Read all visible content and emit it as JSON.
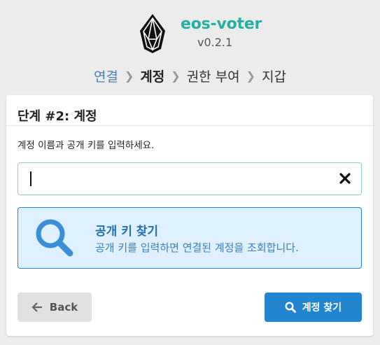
{
  "header": {
    "app_name": "eos-voter",
    "version": "v0.2.1",
    "logo_icon": "eos-logo-icon"
  },
  "steps": [
    {
      "label": "연결",
      "state": "link"
    },
    {
      "label": "계정",
      "state": "active"
    },
    {
      "label": "권한 부여",
      "state": "normal"
    },
    {
      "label": "지갑",
      "state": "normal"
    }
  ],
  "card": {
    "title": "단계 #2: 계정",
    "description": "계정 이름과 공개 키를 입력하세요.",
    "input": {
      "value": "",
      "placeholder": ""
    },
    "info": {
      "title": "공개 키 찾기",
      "text": "공개 키를 입력하면 연결된 계정을 조회합니다."
    },
    "back_label": "Back",
    "lookup_label": "계정 찾기"
  },
  "colors": {
    "brand": "#25b0a4",
    "primary": "#2185d0",
    "info_bg": "#dff0ff"
  }
}
